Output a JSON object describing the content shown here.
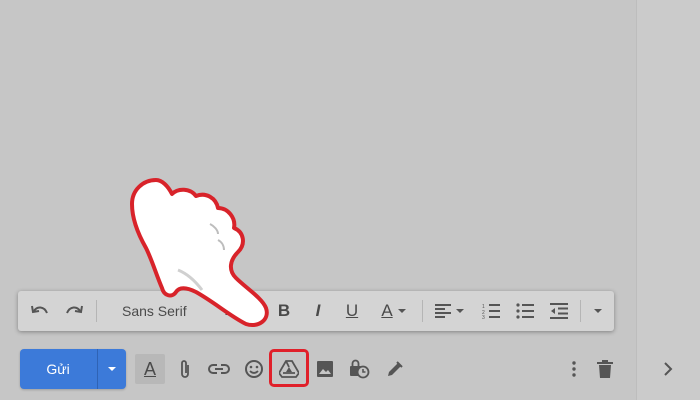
{
  "compose": {
    "send_label": "Gửi"
  },
  "format_toolbar": {
    "font_name": "Sans Serif",
    "font_size_icon": "text-size-icon",
    "bold_letter": "B",
    "italic_letter": "I",
    "underline_letter": "U",
    "text_color_letter": "A"
  },
  "bottom_toolbar": {
    "format_toggle_letter": "A",
    "icons": [
      "format-text-icon",
      "attach-icon",
      "link-icon",
      "emoji-icon",
      "drive-icon",
      "photo-icon",
      "confidential-mode-icon",
      "signature-icon",
      "more-options-icon",
      "trash-icon"
    ]
  },
  "colors": {
    "send_button": "#3c7ad9",
    "highlight": "#e0202a",
    "background": "#c6c6c6"
  }
}
